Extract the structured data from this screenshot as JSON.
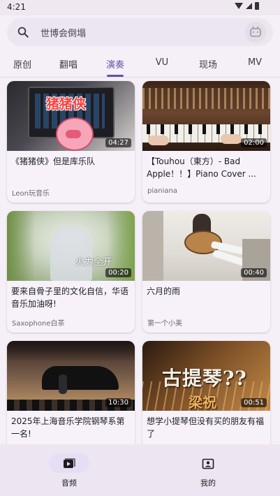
{
  "status": {
    "time": "4:21"
  },
  "search": {
    "placeholder": "世博会倒塌"
  },
  "tabs": [
    {
      "label": "原创",
      "active": false
    },
    {
      "label": "翻唱",
      "active": false
    },
    {
      "label": "演奏",
      "active": true
    },
    {
      "label": "VU",
      "active": false
    },
    {
      "label": "现场",
      "active": false
    },
    {
      "label": "MV",
      "active": false
    }
  ],
  "videos": [
    {
      "title": "《猪猪侠》但是库乐队",
      "author": "Leon玩音乐",
      "duration": "04:27",
      "thumb_caption": "猪猪侠"
    },
    {
      "title": "【Touhou（東方）- Bad Apple！！】Piano Cover ...",
      "author": "pianiana",
      "duration": "02:00"
    },
    {
      "title": "要来自骨子里的文化自信，华语音乐加油呀!",
      "author": "Saxophone白茶",
      "duration": "00:20",
      "thumb_caption": "火力全开"
    },
    {
      "title": "六月的雨",
      "author": "第一个小美",
      "duration": "00:40"
    },
    {
      "title": "2025年上海音乐学院钢琴系第一名!",
      "author": "",
      "duration": "10:30"
    },
    {
      "title": "想学小提琴但没有买的朋友有福了",
      "author": "",
      "duration": "00:51",
      "thumb_caption": "古提琴??",
      "thumb_caption2": "梁祝"
    }
  ],
  "nav": [
    {
      "label": "音频",
      "active": true,
      "icon": "video-library-icon"
    },
    {
      "label": "我的",
      "active": false,
      "icon": "profile-icon"
    }
  ],
  "colors": {
    "accent": "#6750a4",
    "background": "#f5eff7"
  }
}
